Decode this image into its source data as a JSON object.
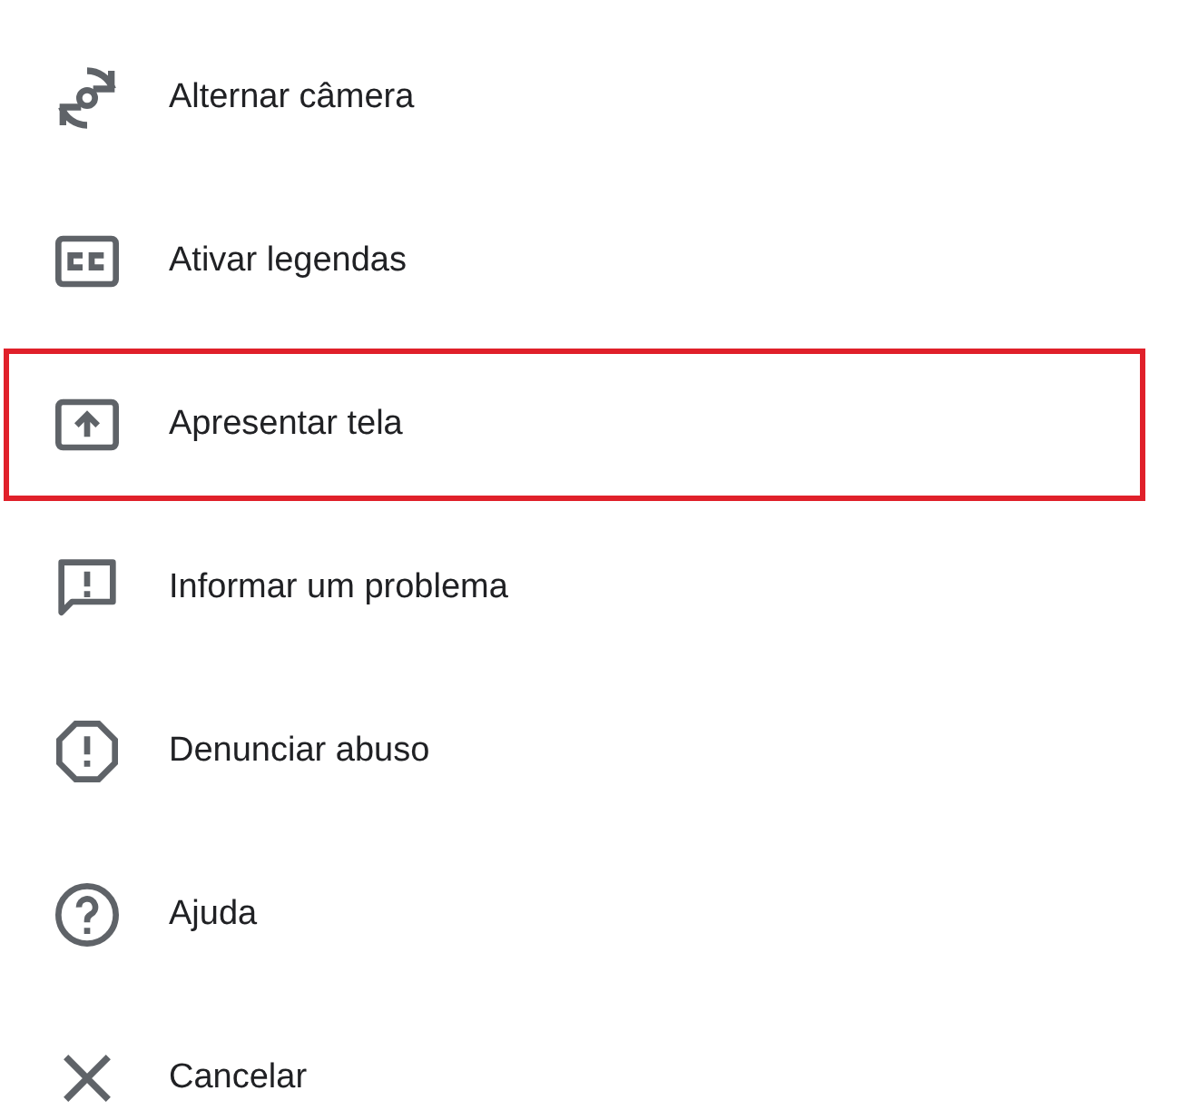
{
  "menu": {
    "items": [
      {
        "kind": "switch-camera",
        "label": "Alternar câmera",
        "highlighted": false
      },
      {
        "kind": "captions",
        "label": "Ativar legendas",
        "highlighted": false
      },
      {
        "kind": "present",
        "label": "Apresentar tela",
        "highlighted": true
      },
      {
        "kind": "feedback",
        "label": "Informar um problema",
        "highlighted": false
      },
      {
        "kind": "report",
        "label": "Denunciar abuso",
        "highlighted": false
      },
      {
        "kind": "help",
        "label": "Ajuda",
        "highlighted": false
      },
      {
        "kind": "close",
        "label": "Cancelar",
        "highlighted": false
      }
    ]
  }
}
